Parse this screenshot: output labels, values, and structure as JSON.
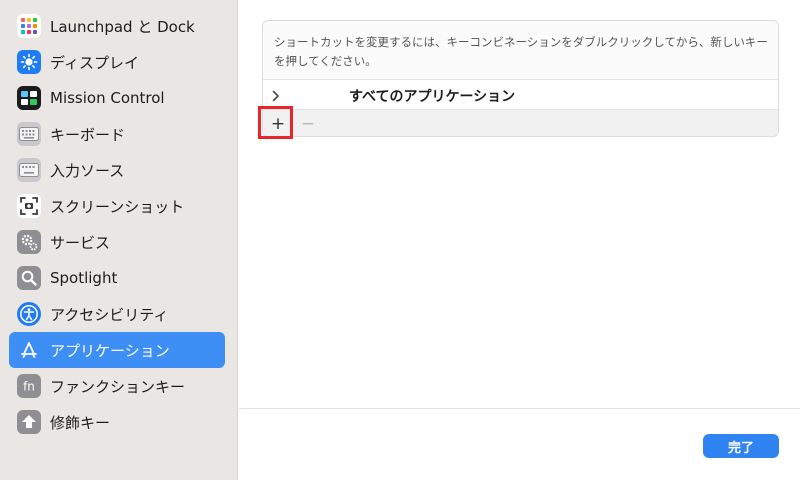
{
  "sidebar": {
    "items": [
      {
        "label": "Launchpad と Dock",
        "icon": "launchpad-icon"
      },
      {
        "label": "ディスプレイ",
        "icon": "display-icon"
      },
      {
        "label": "Mission Control",
        "icon": "mission-control-icon"
      },
      {
        "label": "キーボード",
        "icon": "keyboard-icon"
      },
      {
        "label": "入力ソース",
        "icon": "input-source-icon"
      },
      {
        "label": "スクリーンショット",
        "icon": "screenshot-icon"
      },
      {
        "label": "サービス",
        "icon": "services-gear-icon"
      },
      {
        "label": "Spotlight",
        "icon": "spotlight-search-icon"
      },
      {
        "label": "アクセシビリティ",
        "icon": "accessibility-icon"
      },
      {
        "label": "アプリケーション",
        "icon": "app-store-icon",
        "selected": true
      },
      {
        "label": "ファンクションキー",
        "icon": "fn-key-icon"
      },
      {
        "label": "修飾キー",
        "icon": "modifier-key-icon"
      }
    ],
    "selected_color": "#3d8ef5"
  },
  "main": {
    "hint": "ショートカットを変更するには、キーコンビネーションをダブルクリックしてから、新しいキーを押してください。",
    "all_apps_label": "すべてのアプリケーション",
    "add_label": "+",
    "remove_label": "−",
    "done_label": "完了"
  },
  "colors": {
    "accent": "#2f84f2",
    "highlight": "#e8262a"
  }
}
